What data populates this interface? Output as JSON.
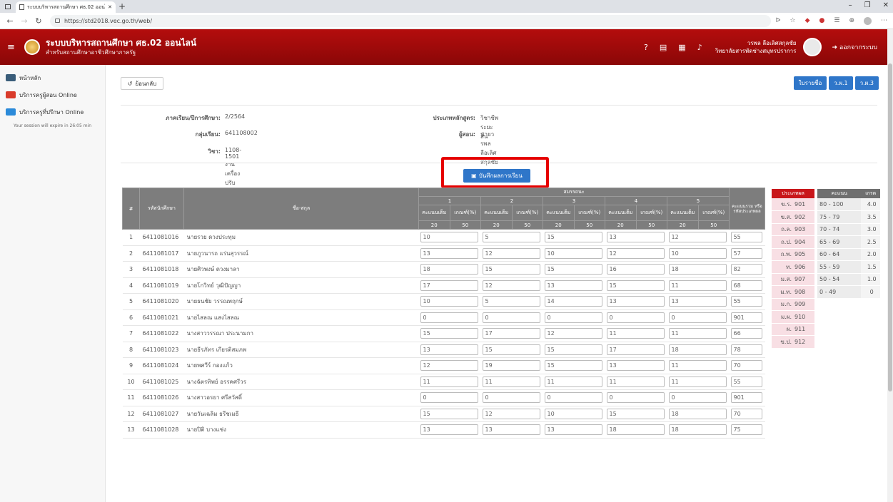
{
  "browser": {
    "tab_title": "ระบบบริหารสถานศึกษา ศธ.02 ออนไ",
    "url": "https://std2018.vec.go.th/web/"
  },
  "app": {
    "title": "ระบบบริหารสถานศึกษา ศธ.02 ออนไลน์",
    "subtitle": "สำหรับสถานศึกษาอาชีวศึกษาภาครัฐ",
    "user_name": "วรพล ลือเลิศสกุลชัย",
    "user_org": "วิทยาลัยสารพัดช่างสมุทรปราการ",
    "logout": "ออกจากระบบ"
  },
  "sidebar": {
    "items": [
      {
        "label": "หน้าหลัก",
        "icon": "dashboard-icon",
        "color": "#3a5d7a"
      },
      {
        "label": "บริการครูผู้สอน Online",
        "icon": "teacher-icon",
        "color": "#d93b2b"
      },
      {
        "label": "บริการครูที่ปรึกษา Online",
        "icon": "monitor-icon",
        "color": "#2b8ad9"
      }
    ],
    "session": "Your session will expire in 26:05 min"
  },
  "toolbar": {
    "back": "ย้อนกลับ",
    "buttons": [
      "ใบรายชื่อ",
      "ว.ผ.1",
      "ว.ผ.3"
    ]
  },
  "info": {
    "term_label": "ภาคเรียน/ปีการศึกษา:",
    "term": "2/2564",
    "group_label": "กลุ่มเรียน:",
    "group": "641108002",
    "subject_label": "วิชา:",
    "subject": "1108-1501 งานเครื่องปรับอากาศ",
    "course_label": "ประเภทหลักสูตร:",
    "course": "วิชาชีพระยะสั้น",
    "teacher_label": "ผู้สอน:",
    "teacher": "นายวรพล ลือเลิศสกุลชัย"
  },
  "save_button": "บันทึกผลการเรียน",
  "table": {
    "h_no": "#",
    "h_id": "รหัสนักศึกษา",
    "h_name": "ชื่อ-สกุล",
    "h_comp": "สมรรถนะ",
    "h_total": "คะแนนรวม หรือ รหัสประเภทผล",
    "h_full": "คะแนนเต็ม",
    "h_crit": "เกณฑ์(%)",
    "groups": [
      "1",
      "2",
      "3",
      "4",
      "5"
    ],
    "full": [
      "20",
      "50",
      "20",
      "50",
      "20",
      "50",
      "20",
      "50",
      "20",
      "50"
    ],
    "rows": [
      {
        "no": "1",
        "id": "6411081016",
        "name": "นายรวย ดวงประทุม",
        "s": [
          "10",
          "5",
          "15",
          "13",
          "12"
        ],
        "t": "55"
      },
      {
        "no": "2",
        "id": "6411081017",
        "name": "นายภูวนารถ แร่นสุวรรณ์",
        "s": [
          "13",
          "12",
          "10",
          "12",
          "10"
        ],
        "t": "57"
      },
      {
        "no": "3",
        "id": "6411081018",
        "name": "นายศิวพงษ์ ดวงมาลา",
        "s": [
          "18",
          "15",
          "15",
          "16",
          "18"
        ],
        "t": "82"
      },
      {
        "no": "4",
        "id": "6411081019",
        "name": "นายโกวิทย์ วุฒิปัญญา",
        "s": [
          "17",
          "12",
          "13",
          "15",
          "11"
        ],
        "t": "68"
      },
      {
        "no": "5",
        "id": "6411081020",
        "name": "นายธนชัย วรรณพฤกษ์",
        "s": [
          "10",
          "5",
          "14",
          "13",
          "13"
        ],
        "t": "55"
      },
      {
        "no": "6",
        "id": "6411081021",
        "name": "นายไสลณ แสงไสลณ",
        "s": [
          "0",
          "0",
          "0",
          "0",
          "0"
        ],
        "t": "901"
      },
      {
        "no": "7",
        "id": "6411081022",
        "name": "นางสาววรรณา ประนามกา",
        "s": [
          "15",
          "17",
          "12",
          "11",
          "11"
        ],
        "t": "66"
      },
      {
        "no": "8",
        "id": "6411081023",
        "name": "นายธีรภัทร เกียรติสมภพ",
        "s": [
          "13",
          "15",
          "15",
          "17",
          "18"
        ],
        "t": "78"
      },
      {
        "no": "9",
        "id": "6411081024",
        "name": "นายพศวีร์ กองแก้ว",
        "s": [
          "12",
          "19",
          "15",
          "13",
          "11"
        ],
        "t": "70"
      },
      {
        "no": "10",
        "id": "6411081025",
        "name": "นางฉัตรทิพย์ อรรคศรีวร",
        "s": [
          "11",
          "11",
          "11",
          "11",
          "11"
        ],
        "t": "55"
      },
      {
        "no": "11",
        "id": "6411081026",
        "name": "นางสาวอรยา ศรีสวัสดิ์",
        "s": [
          "0",
          "0",
          "0",
          "0",
          "0"
        ],
        "t": "901"
      },
      {
        "no": "12",
        "id": "6411081027",
        "name": "นายวันเฉลิม ธรีชเมธี",
        "s": [
          "15",
          "12",
          "10",
          "15",
          "18"
        ],
        "t": "70"
      },
      {
        "no": "13",
        "id": "6411081028",
        "name": "นายปิติ บางแช่ง",
        "s": [
          "13",
          "13",
          "13",
          "18",
          "18"
        ],
        "t": "75"
      }
    ]
  },
  "result_types": {
    "header": "ประเภทผล",
    "items": [
      [
        "ข.ร.",
        "901"
      ],
      [
        "ข.ส.",
        "902"
      ],
      [
        "ถ.ล.",
        "903"
      ],
      [
        "ถ.ป.",
        "904"
      ],
      [
        "ถ.พ.",
        "905"
      ],
      [
        "ท.",
        "906"
      ],
      [
        "ม.ส.",
        "907"
      ],
      [
        "ม.ท.",
        "908"
      ],
      [
        "ม.ก.",
        "909"
      ],
      [
        "ม.ผ.",
        "910"
      ],
      [
        "ผ.",
        "911"
      ],
      [
        "ข.ป.",
        "912"
      ]
    ]
  },
  "grade_scale": {
    "h_score": "คะแนน",
    "h_grade": "เกรด",
    "items": [
      [
        "80 - 100",
        "4.0"
      ],
      [
        "75 - 79",
        "3.5"
      ],
      [
        "70 - 74",
        "3.0"
      ],
      [
        "65 - 69",
        "2.5"
      ],
      [
        "60 - 64",
        "2.0"
      ],
      [
        "55 - 59",
        "1.5"
      ],
      [
        "50 - 54",
        "1.0"
      ],
      [
        "0 - 49",
        "0"
      ]
    ]
  }
}
